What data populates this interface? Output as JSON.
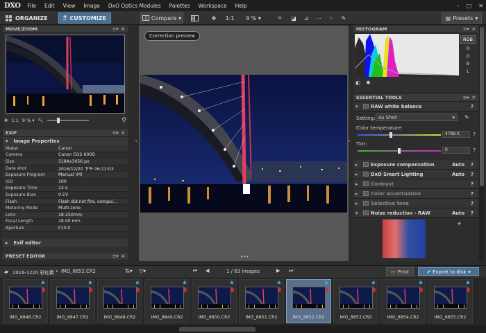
{
  "app": {
    "logo": "DXO"
  },
  "menu": [
    "File",
    "Edit",
    "View",
    "Image",
    "DxO Optics Modules",
    "Palettes",
    "Workspace",
    "Help"
  ],
  "window_controls": [
    "–",
    "□",
    "✕"
  ],
  "toolbar": {
    "organize": "ORGANIZE",
    "customize": "CUSTOMIZE",
    "compare": "Compare",
    "zoom_1_1": "1:1",
    "zoom_pct": "9 %",
    "presets": "Presets"
  },
  "move_zoom": {
    "title": "MOVE/ZOOM",
    "ratio": "1:1",
    "zoom": "9 %"
  },
  "exif": {
    "title": "EXIF",
    "section": "Image Properties",
    "rows": [
      {
        "k": "Maker",
        "v": "Canon"
      },
      {
        "k": "Camera",
        "v": "Canon EOS 600D"
      },
      {
        "k": "Size",
        "v": "5184x3456 px"
      },
      {
        "k": "Date shot",
        "v": "2016/12/20 下午 06:12:03"
      },
      {
        "k": "Exposure Program",
        "v": "Manual (M)"
      },
      {
        "k": "ISO",
        "v": "100"
      },
      {
        "k": "Exposure Time",
        "v": "13 s"
      },
      {
        "k": "Exposure Bias",
        "v": "0 EV"
      },
      {
        "k": "Flash",
        "v": "Flash did not fire, compul..."
      },
      {
        "k": "Metering Mode",
        "v": "Multi-zone"
      },
      {
        "k": "Lens",
        "v": "18-250mm"
      },
      {
        "k": "Focal Length",
        "v": "18.00 mm"
      },
      {
        "k": "Aperture",
        "v": "F13.0"
      }
    ],
    "exif_editor": "Exif editor"
  },
  "preset_editor": {
    "title": "PRESET EDITOR"
  },
  "center": {
    "preview_label": "Correction preview"
  },
  "histogram": {
    "title": "HISTOGRAM",
    "channels": [
      "RGB",
      "R",
      "G",
      "B",
      "L"
    ]
  },
  "essential": {
    "title": "ESSENTIAL TOOLS",
    "white_balance": "RAW white balance",
    "setting_label": "Setting:",
    "setting_value": "As Shot",
    "color_temp_label": "Color temperature:",
    "color_temp_value": "4788 K",
    "tint_label": "Tint:",
    "tint_value": "0",
    "tools": [
      {
        "name": "Exposure compensation",
        "auto": "Auto",
        "dim": false
      },
      {
        "name": "DxO Smart Lighting",
        "auto": "Auto",
        "dim": false
      },
      {
        "name": "Contrast",
        "auto": "",
        "dim": true
      },
      {
        "name": "Color accentuation",
        "auto": "",
        "dim": true
      },
      {
        "name": "Selective tone",
        "auto": "",
        "dim": true
      },
      {
        "name": "Noise reduction - RAW",
        "auto": "Auto",
        "dim": false
      }
    ]
  },
  "filmbar": {
    "folder": "2016-1220 彩虹橋",
    "file": "IMG_8852.CR2",
    "count": "1 / 63 images",
    "print": "Print",
    "export": "Export to disk"
  },
  "thumbnails": [
    "IMG_8846.CR2",
    "IMG_8847.CR2",
    "IMG_8848.CR2",
    "IMG_8849.CR2",
    "IMG_8850.CR2",
    "IMG_8851.CR2",
    "IMG_8852.CR2",
    "IMG_8853.CR2",
    "IMG_8854.CR2",
    "IMG_8855.CR2"
  ],
  "selected_thumbnail": 6,
  "colors": {
    "accent": "#4a6f91",
    "selected": "#5a6f8c",
    "star": "#35b6ea"
  }
}
